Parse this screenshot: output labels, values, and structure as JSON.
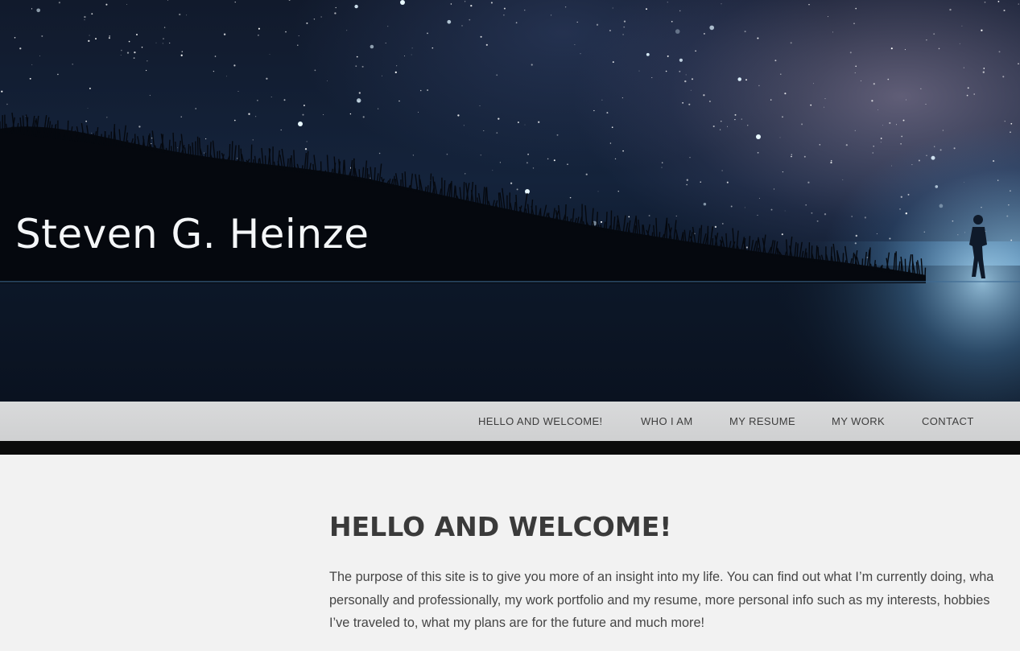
{
  "site": {
    "title": "Steven G. Heinze"
  },
  "nav": {
    "items": [
      {
        "label": "HELLO AND WELCOME!"
      },
      {
        "label": "WHO I AM"
      },
      {
        "label": "MY RESUME"
      },
      {
        "label": "MY WORK"
      },
      {
        "label": "CONTACT"
      }
    ]
  },
  "main": {
    "heading": "HELLO AND WELCOME!",
    "intro_lines": [
      "The purpose of this site is to give you more of an insight into my life. You can find out what I’m currently doing, wha",
      "personally and professionally, my work portfolio and my resume, more personal info such as my interests, hobbies",
      "I’ve traveled to, what my plans are for the future and much more!"
    ]
  },
  "colors": {
    "nav_bg": "#d3d4d5",
    "nav_text": "#3d3d3d",
    "page_bg": "#f2f2f2",
    "heading": "#3a3a3a"
  }
}
